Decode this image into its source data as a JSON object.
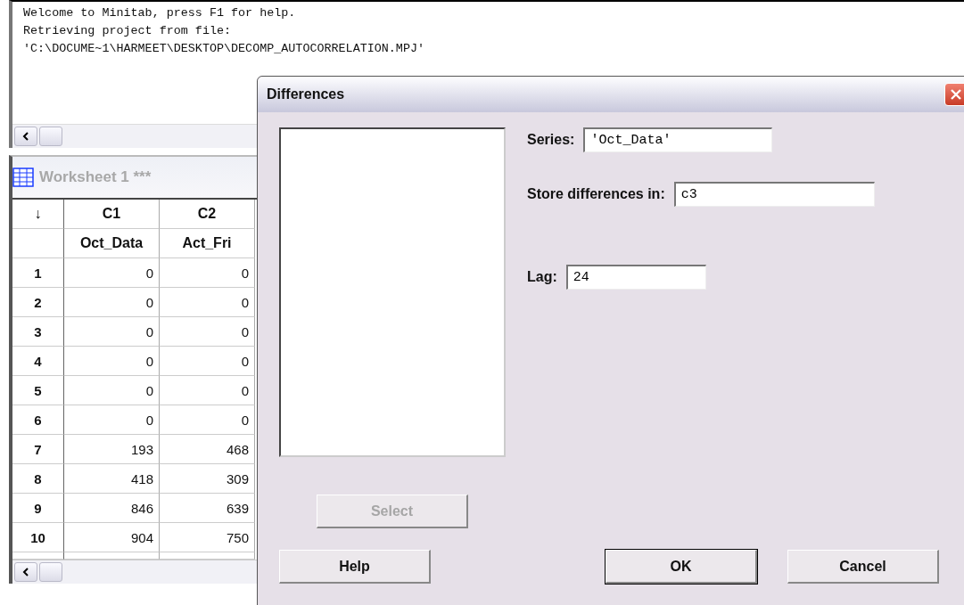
{
  "session": {
    "lines": [
      "Welcome to Minitab, press F1 for help.",
      "Retrieving project from file:",
      "'C:\\DOCUME~1\\HARMEET\\DESKTOP\\DECOMP_AUTOCORRELATION.MPJ'"
    ]
  },
  "worksheet": {
    "title": "Worksheet 1 ***",
    "corner": "↓",
    "columns": [
      {
        "id": "C1",
        "name": "Oct_Data"
      },
      {
        "id": "C2",
        "name": "Act_Fri"
      }
    ],
    "rows": [
      {
        "n": "1",
        "cells": [
          "0",
          "0"
        ]
      },
      {
        "n": "2",
        "cells": [
          "0",
          "0"
        ]
      },
      {
        "n": "3",
        "cells": [
          "0",
          "0"
        ]
      },
      {
        "n": "4",
        "cells": [
          "0",
          "0"
        ]
      },
      {
        "n": "5",
        "cells": [
          "0",
          "0"
        ]
      },
      {
        "n": "6",
        "cells": [
          "0",
          "0"
        ]
      },
      {
        "n": "7",
        "cells": [
          "193",
          "468"
        ]
      },
      {
        "n": "8",
        "cells": [
          "418",
          "309"
        ]
      },
      {
        "n": "9",
        "cells": [
          "846",
          "639"
        ]
      },
      {
        "n": "10",
        "cells": [
          "904",
          "750"
        ]
      }
    ]
  },
  "dialog": {
    "title": "Differences",
    "series": {
      "label": "Series:",
      "value": "'Oct_Data'"
    },
    "store": {
      "label": "Store differences in:",
      "value": "c3"
    },
    "lag": {
      "label": "Lag:",
      "value": "24"
    },
    "buttons": [
      {
        "label": "Select",
        "kind": "select",
        "disabled": true,
        "default": false
      },
      {
        "label": "Help",
        "kind": "help",
        "disabled": false,
        "default": false
      },
      {
        "label": "OK",
        "kind": "ok",
        "disabled": false,
        "default": true
      },
      {
        "label": "Cancel",
        "kind": "cancel",
        "disabled": false,
        "default": false
      }
    ]
  }
}
